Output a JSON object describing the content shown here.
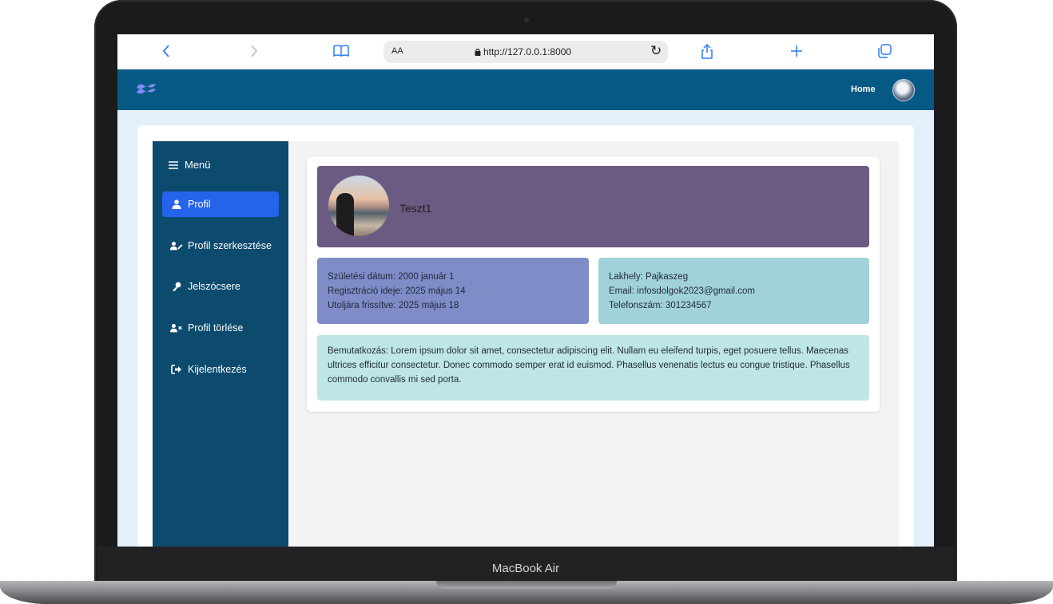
{
  "device": {
    "label": "MacBook Air"
  },
  "browser": {
    "text_size_label": "AA",
    "url": "http://127.0.0.1:8000",
    "icons": [
      "chevron-left-icon",
      "chevron-right-icon",
      "book-icon",
      "lock-icon",
      "reload-icon",
      "share-icon",
      "plus-icon",
      "tabs-icon"
    ]
  },
  "header": {
    "home_label": "Home",
    "accent_color": "#075985"
  },
  "sidebar": {
    "title": "Menü",
    "items": [
      {
        "label": "Profil",
        "active": true
      },
      {
        "label": "Profil szerkesztése",
        "active": false
      },
      {
        "label": "Jelszócsere",
        "active": false
      },
      {
        "label": "Profil törlése",
        "active": false
      },
      {
        "label": "Kijelentkezés",
        "active": false
      }
    ]
  },
  "profile": {
    "username": "Teszt1",
    "details_left": [
      "Születési dátum: 2000 január 1",
      "Regisztráció ideje: 2025 május 14",
      "Utoljára frissítve: 2025 május 18"
    ],
    "details_right": [
      "Lakhely: Pajkaszeg",
      "Email: infosdolgok2023@gmail.com",
      "Telefonszám: 301234567"
    ],
    "bio": "Bemutatkozás: Lorem ipsum dolor sit amet, consectetur adipiscing elit. Nullam eu eleifend turpis, eget posuere tellus. Maecenas ultrices efficitur consectetur. Donec commodo semper erat id euismod. Phasellus venenatis lectus eu congue tristique. Phasellus commodo convallis mi sed porta."
  }
}
